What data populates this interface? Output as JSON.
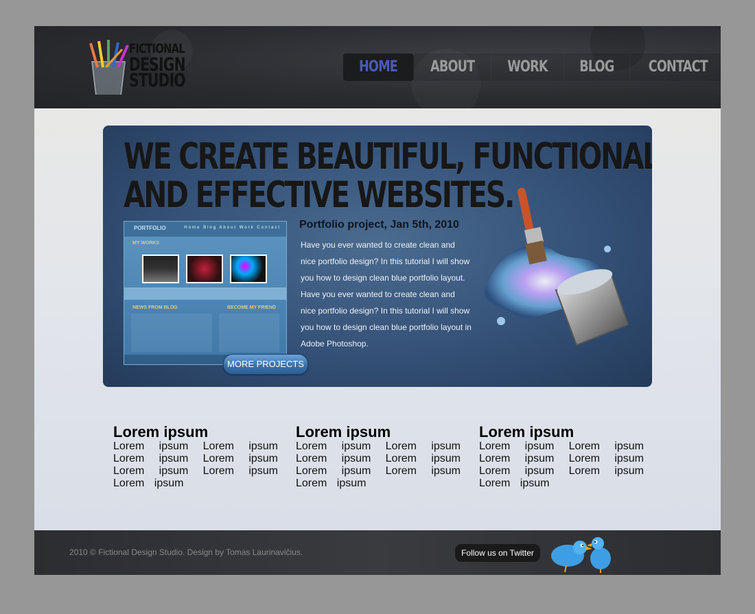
{
  "logo": {
    "line1": "Fictional",
    "line2": "Design",
    "line3": "Studio"
  },
  "nav": [
    {
      "label": "Home",
      "active": true
    },
    {
      "label": "About",
      "active": false
    },
    {
      "label": "Work",
      "active": false
    },
    {
      "label": "Blog",
      "active": false
    },
    {
      "label": "Contact",
      "active": false
    }
  ],
  "hero": {
    "title_line1": "We create beautiful, functional",
    "title_line2": "and effective websites.",
    "project_title": "Portfolio project, Jan 5th, 2010",
    "project_desc": "Have you ever wanted to create clean and nice portfolio design? In this tutorial I will show you how to design clean blue portfolio layout. Have you ever wanted to create clean and nice portfolio design? In this tutorial I will show you how to design clean blue portfolio layout in Adobe Photoshop.",
    "more_button": "MORE PROJECTS",
    "thumb": {
      "title": "PORTFOLIO",
      "nav": "Home Blog About Work Contact",
      "section1": "MY WORKS",
      "section2": "NEWS FROM BLOG",
      "section3": "BECOME MY FRIEND"
    }
  },
  "columns": [
    {
      "title": "Lorem ipsum",
      "body": "Lorem ipsum Lorem ipsum Lorem ipsum Lorem ipsum Lorem ipsum Lorem ipsum Lorem ipsum"
    },
    {
      "title": "Lorem ipsum",
      "body": "Lorem ipsum Lorem ipsum Lorem ipsum Lorem ipsum Lorem ipsum Lorem ipsum Lorem ipsum"
    },
    {
      "title": "Lorem ipsum",
      "body": "Lorem ipsum Lorem ipsum Lorem ipsum Lorem ipsum Lorem ipsum Lorem ipsum Lorem ipsum"
    }
  ],
  "footer": {
    "copyright": "2010 © Fictional Design Studio. Design by Tomas Laurinavičius.",
    "follow": "Follow us on Twitter"
  },
  "colors": {
    "page_bg": "#979797",
    "header_bg": "#2a2c30",
    "nav_active": "#4a5ab8",
    "hero_blue": "#36537a",
    "button_blue": "#3d72ad"
  },
  "icons": [
    "pencil-cup-icon",
    "paintbrush-bucket-icon",
    "twitter-birds-icon"
  ]
}
